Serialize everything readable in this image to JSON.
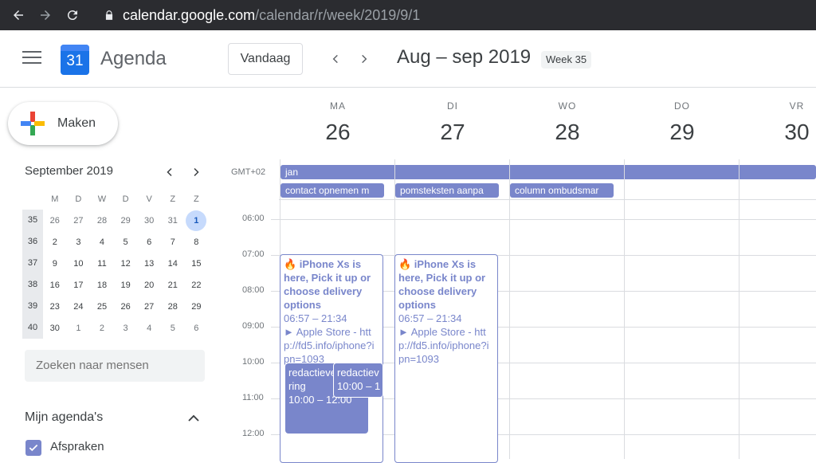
{
  "browser": {
    "url_host": "calendar.google.com",
    "url_path": "/calendar/r/week/2019/9/1"
  },
  "header": {
    "app_title": "Agenda",
    "logo_number": "31",
    "today_label": "Vandaag",
    "period": "Aug – sep 2019",
    "week_badge": "Week 35"
  },
  "sidebar": {
    "create_label": "Maken",
    "mini_calendar": {
      "month": "September 2019",
      "weekday_headers": [
        "M",
        "D",
        "W",
        "D",
        "V",
        "Z",
        "Z"
      ],
      "weeks": [
        {
          "wk": "35",
          "days": [
            "26",
            "27",
            "28",
            "29",
            "30",
            "31",
            "1"
          ]
        },
        {
          "wk": "36",
          "days": [
            "2",
            "3",
            "4",
            "5",
            "6",
            "7",
            "8"
          ]
        },
        {
          "wk": "37",
          "days": [
            "9",
            "10",
            "11",
            "12",
            "13",
            "14",
            "15"
          ]
        },
        {
          "wk": "38",
          "days": [
            "16",
            "17",
            "18",
            "19",
            "20",
            "21",
            "22"
          ]
        },
        {
          "wk": "39",
          "days": [
            "23",
            "24",
            "25",
            "26",
            "27",
            "28",
            "29"
          ]
        },
        {
          "wk": "40",
          "days": [
            "30",
            "1",
            "2",
            "3",
            "4",
            "5",
            "6"
          ]
        }
      ],
      "selected_day": "1"
    },
    "search_placeholder": "Zoeken naar mensen",
    "my_calendars_label": "Mijn agenda's",
    "calendars": [
      {
        "name": "Afspraken",
        "checked": true,
        "color": "#7986cb"
      }
    ]
  },
  "week_view": {
    "timezone": "GMT+02",
    "days": [
      {
        "name": "MA",
        "num": "26"
      },
      {
        "name": "DI",
        "num": "27"
      },
      {
        "name": "WO",
        "num": "28"
      },
      {
        "name": "DO",
        "num": "29"
      },
      {
        "name": "VR",
        "num": "30"
      }
    ],
    "hours": [
      "06:00",
      "07:00",
      "08:00",
      "09:00",
      "10:00",
      "11:00",
      "12:00"
    ],
    "allday_events": [
      {
        "label": "jan",
        "day": "MA"
      },
      {
        "label": "contact opnemen m",
        "day": "MA"
      },
      {
        "label": "pomsteksten aanpa",
        "day": "DI"
      },
      {
        "label": "column ombudsmar",
        "day": "WO"
      }
    ],
    "timed_events": [
      {
        "day": "MA",
        "title": "🔥 iPhone Xs is here, Pick it up or choose delivery options",
        "time": "06:57 – 21:34",
        "location": "► Apple Store - http://fd5.info/iphone?ipn=1093"
      },
      {
        "day": "DI",
        "title": "🔥 iPhone Xs is here, Pick it up or choose delivery options",
        "time": "06:57 – 21:34",
        "location": "► Apple Store - http://fd5.info/iphone?ipn=1093"
      },
      {
        "day": "MA",
        "title": "redactievergadering",
        "time": "10:00 – 12:00"
      },
      {
        "day": "MA",
        "title": "redactiev",
        "time": "10:00 – 1"
      }
    ]
  },
  "colors": {
    "event": "#7986cb",
    "browser_bar": "#2b2c30",
    "selected_day_bg": "#c6dafc"
  }
}
